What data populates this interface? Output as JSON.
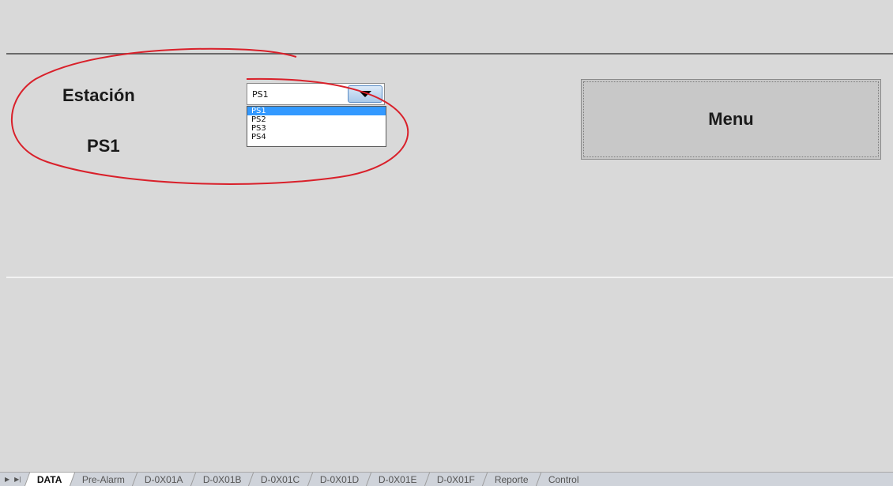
{
  "station": {
    "label": "Estación",
    "value": "PS1",
    "combo_value": "PS1",
    "options": [
      "PS1",
      "PS2",
      "PS3",
      "PS4"
    ],
    "selected_option": "PS1"
  },
  "menu_button": {
    "label": "Menu"
  },
  "tabs": [
    "DATA",
    "Pre-Alarm",
    "D-0X01A",
    "D-0X01B",
    "D-0X01C",
    "D-0X01D",
    "D-0X01E",
    "D-0X01F",
    "Reporte",
    "Control"
  ],
  "active_tab": "DATA",
  "tab_nav": {
    "next": "▶",
    "last": "▶|"
  },
  "colors": {
    "background": "#d9d9d9",
    "annotation_ellipse": "#d9202a",
    "selection_highlight": "#3399ff",
    "dropdown_button": "#a9c9ea"
  },
  "icons": {
    "combo_button": "triangle-down-icon",
    "tab_next": "play-icon",
    "tab_last": "skip-end-icon"
  }
}
